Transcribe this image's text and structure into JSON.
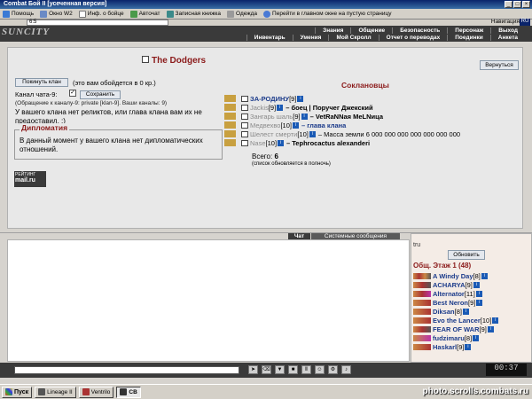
{
  "window": {
    "title": "Combat Бой II [усеченная версия]"
  },
  "toolbar": {
    "items": [
      "Помощь",
      "Окно W2",
      "Инф. о бойце",
      "Авточат",
      "Записная книжка",
      "Одежда",
      "Перейти в главном окне на пустую страницу"
    ]
  },
  "navbar": {
    "address": "6:5",
    "nav_label": "Навигация",
    "lang": "RU"
  },
  "header": {
    "logo": "SUNCITY",
    "menu_top": [
      "Знания",
      "Общение",
      "Безопасность",
      "Персонаж",
      "Выход"
    ],
    "menu_bottom": [
      "Инвентарь",
      "Умения",
      "Мой Скролл",
      "Отчет о переводах",
      "Поединки",
      "Анкета"
    ]
  },
  "clan": {
    "name": "The Dodgers",
    "back_label": "Вернуться",
    "leave_label": "Покинуть клан",
    "fee_text": "(это вам обойдется в 0 кр.)",
    "channel_label": "Канал чата-9:",
    "channel_checked": "✓",
    "save_label": "Сохранить",
    "channel_hint": "(Обращение к каналу-9: private [klan-9]. Ваши каналы: 9)",
    "no_relics": "У вашего клана нет реликтов, или глава клана вам их не предоставил. ;)",
    "diplomacy_title": "Дипломатия",
    "diplomacy_text": "В данный момент у вашего клана нет дипломатических отношений."
  },
  "counter": {
    "line1": "РЕЙТИНГ",
    "line2": "mail.ru"
  },
  "allies": {
    "title": "Соклановцы",
    "members": [
      {
        "name": "ЗА-РОДИНУ",
        "level": "[9]",
        "status": "",
        "online": true
      },
      {
        "name": "Jackis",
        "level": "[9]",
        "status": "– боец | Поручег Джекский",
        "online": false
      },
      {
        "name": "Зангарь шаль",
        "level": "[9]",
        "status": "– VetRaNNaя MeLNица",
        "online": false
      },
      {
        "name": "Медвехво",
        "level": "[10]",
        "status": "– глава клана",
        "online": false
      },
      {
        "name": "Шелест смерти",
        "level": "[10]",
        "status": "– Масса земли 6 000 000 000 000 000 000 000",
        "online": false
      },
      {
        "name": "Nase",
        "level": "[10]",
        "status": "– Tephrocactus alexanderi",
        "online": false
      }
    ],
    "total_label": "Всего:",
    "total": "6",
    "note": "(список обновляется в полночь)"
  },
  "chat": {
    "tab_chat": "Чат",
    "tab_system": "Системные сообщения"
  },
  "room": {
    "location": "tru",
    "refresh_label": "Обновить",
    "header": "Общ. Этаж 1 (48)",
    "users": [
      {
        "name": "A Windy Day",
        "level": "[8]"
      },
      {
        "name": "ACHARYA",
        "level": "[9]"
      },
      {
        "name": "Alternator",
        "level": "[11]"
      },
      {
        "name": "Best Neron",
        "level": "[9]"
      },
      {
        "name": "Diksan",
        "level": "[8]"
      },
      {
        "name": "Evo the Lancer",
        "level": "[10]"
      },
      {
        "name": "FEAR OF WAR",
        "level": "[9]"
      },
      {
        "name": "fudzimaru",
        "level": "[8]"
      },
      {
        "name": "Haskarl",
        "level": "[9]"
      }
    ]
  },
  "clock": "00:37",
  "taskbar": {
    "start": "Пуск",
    "tasks": [
      "Lineage II",
      "Ventrilo",
      "СВ"
    ],
    "watermark": "photo.scrolls.combats.ru"
  },
  "colors": {
    "accent": "#8b1a1a",
    "link": "#1a3a8a",
    "header_bg": "#3a3a3a"
  }
}
